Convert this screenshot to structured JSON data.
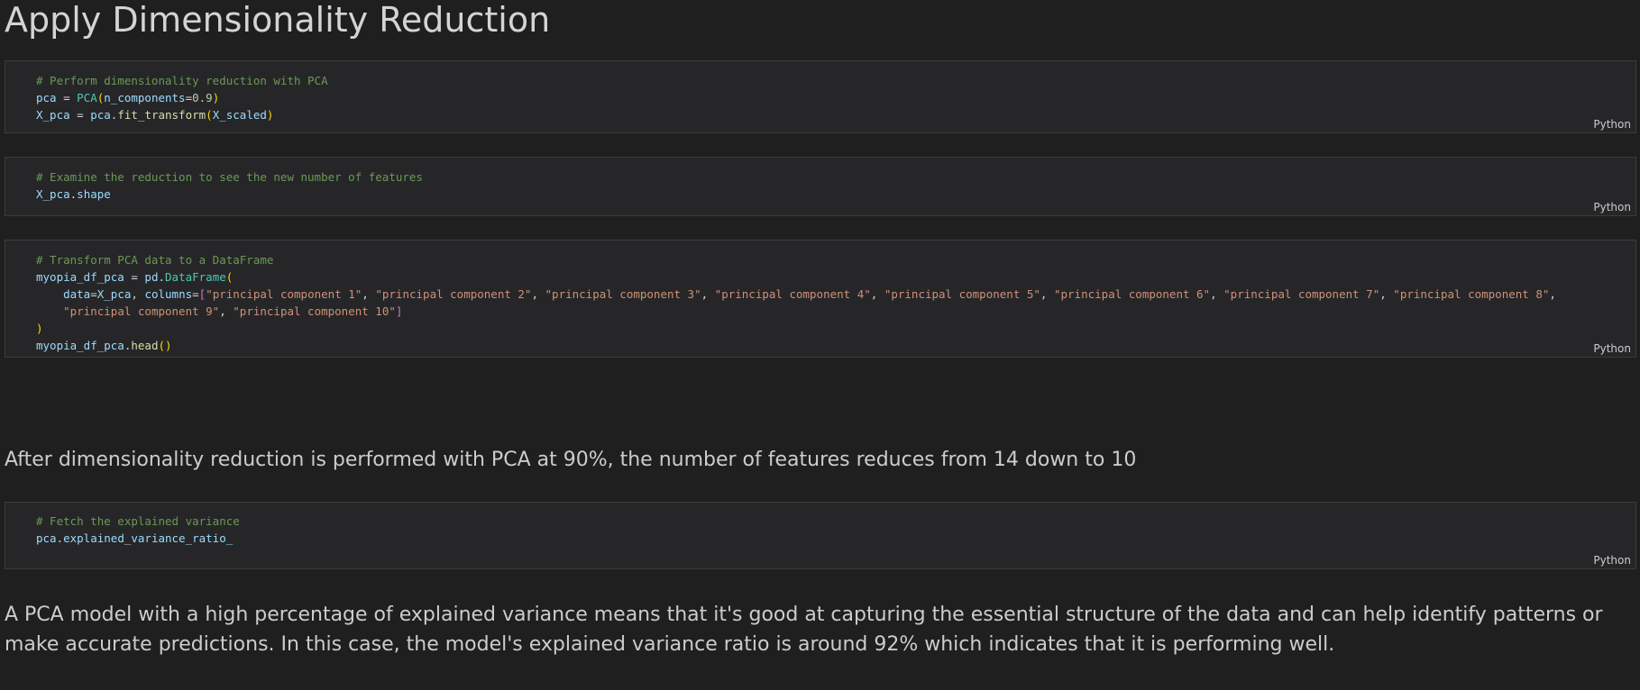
{
  "heading": "Apply Dimensionality Reduction",
  "cells": [
    {
      "language": "Python",
      "lines": [
        [
          "# Perform dimensionality reduction with PCA"
        ],
        [
          "pca",
          " = ",
          "PCA",
          "(",
          "n_components",
          "=",
          "0.9",
          ")"
        ],
        [
          "X_pca",
          " = ",
          "pca",
          ".",
          "fit_transform",
          "(",
          "X_scaled",
          ")"
        ]
      ]
    },
    {
      "language": "Python",
      "lines": [
        [
          "# Examine the reduction to see the new number of features"
        ],
        [
          "X_pca",
          ".",
          "shape"
        ]
      ]
    },
    {
      "language": "Python",
      "lines": [
        [
          "# Transform PCA data to a DataFrame"
        ],
        [
          "myopia_df_pca",
          " = ",
          "pd",
          ".",
          "DataFrame",
          "("
        ],
        [
          "    ",
          "data",
          "=",
          "X_pca",
          ", ",
          "columns",
          "=",
          "[",
          "\"principal component 1\"",
          ", ",
          "\"principal component 2\"",
          ", ",
          "\"principal component 3\"",
          ", ",
          "\"principal component 4\"",
          ", ",
          "\"principal component 5\"",
          ", ",
          "\"principal component 6\"",
          ", ",
          "\"principal component 7\"",
          ", ",
          "\"principal component 8\"",
          ","
        ],
        [
          "    ",
          "\"principal component 9\"",
          ", ",
          "\"principal component 10\"",
          "]"
        ],
        [
          ")"
        ],
        [
          "myopia_df_pca",
          ".",
          "head",
          "()"
        ]
      ]
    },
    {
      "language": "Python",
      "lines": [
        [
          "# Fetch the explained variance"
        ],
        [
          "pca",
          ".",
          "explained_variance_ratio_"
        ]
      ]
    }
  ],
  "markdown": [
    "After dimensionality reduction is performed with PCA at 90%, the number of features reduces from 14 down to 10",
    "A PCA model with a high percentage of explained variance means that it's good at capturing the essential structure of the data and can help identify patterns or",
    "make accurate predictions. In this case, the model's explained variance ratio is around 92% which indicates that it is performing well."
  ]
}
